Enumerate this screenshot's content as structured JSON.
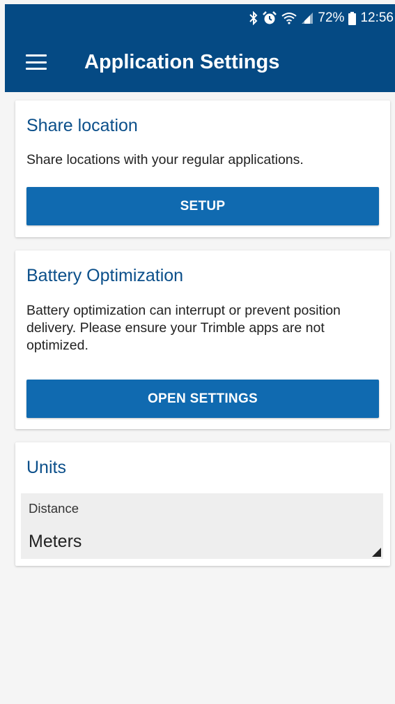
{
  "status_bar": {
    "battery_percent": "72%",
    "time": "12:56",
    "icons": [
      "bluetooth-icon",
      "alarm-icon",
      "wifi-icon",
      "signal-icon",
      "battery-icon"
    ]
  },
  "app_bar": {
    "title": "Application Settings",
    "menu_icon": "hamburger-menu-icon"
  },
  "cards": {
    "share_location": {
      "title": "Share location",
      "description": "Share locations with your regular applications.",
      "button_label": "SETUP"
    },
    "battery": {
      "title": "Battery Optimization",
      "description": "Battery optimization can interrupt or prevent position delivery. Please ensure your Trimble apps are not optimized.",
      "button_label": "OPEN SETTINGS"
    },
    "units": {
      "title": "Units",
      "distance_label": "Distance",
      "distance_value": "Meters"
    }
  },
  "colors": {
    "primary": "#054a84",
    "button": "#106ab0",
    "title_text": "#0b4f8a",
    "background": "#f5f5f5"
  }
}
